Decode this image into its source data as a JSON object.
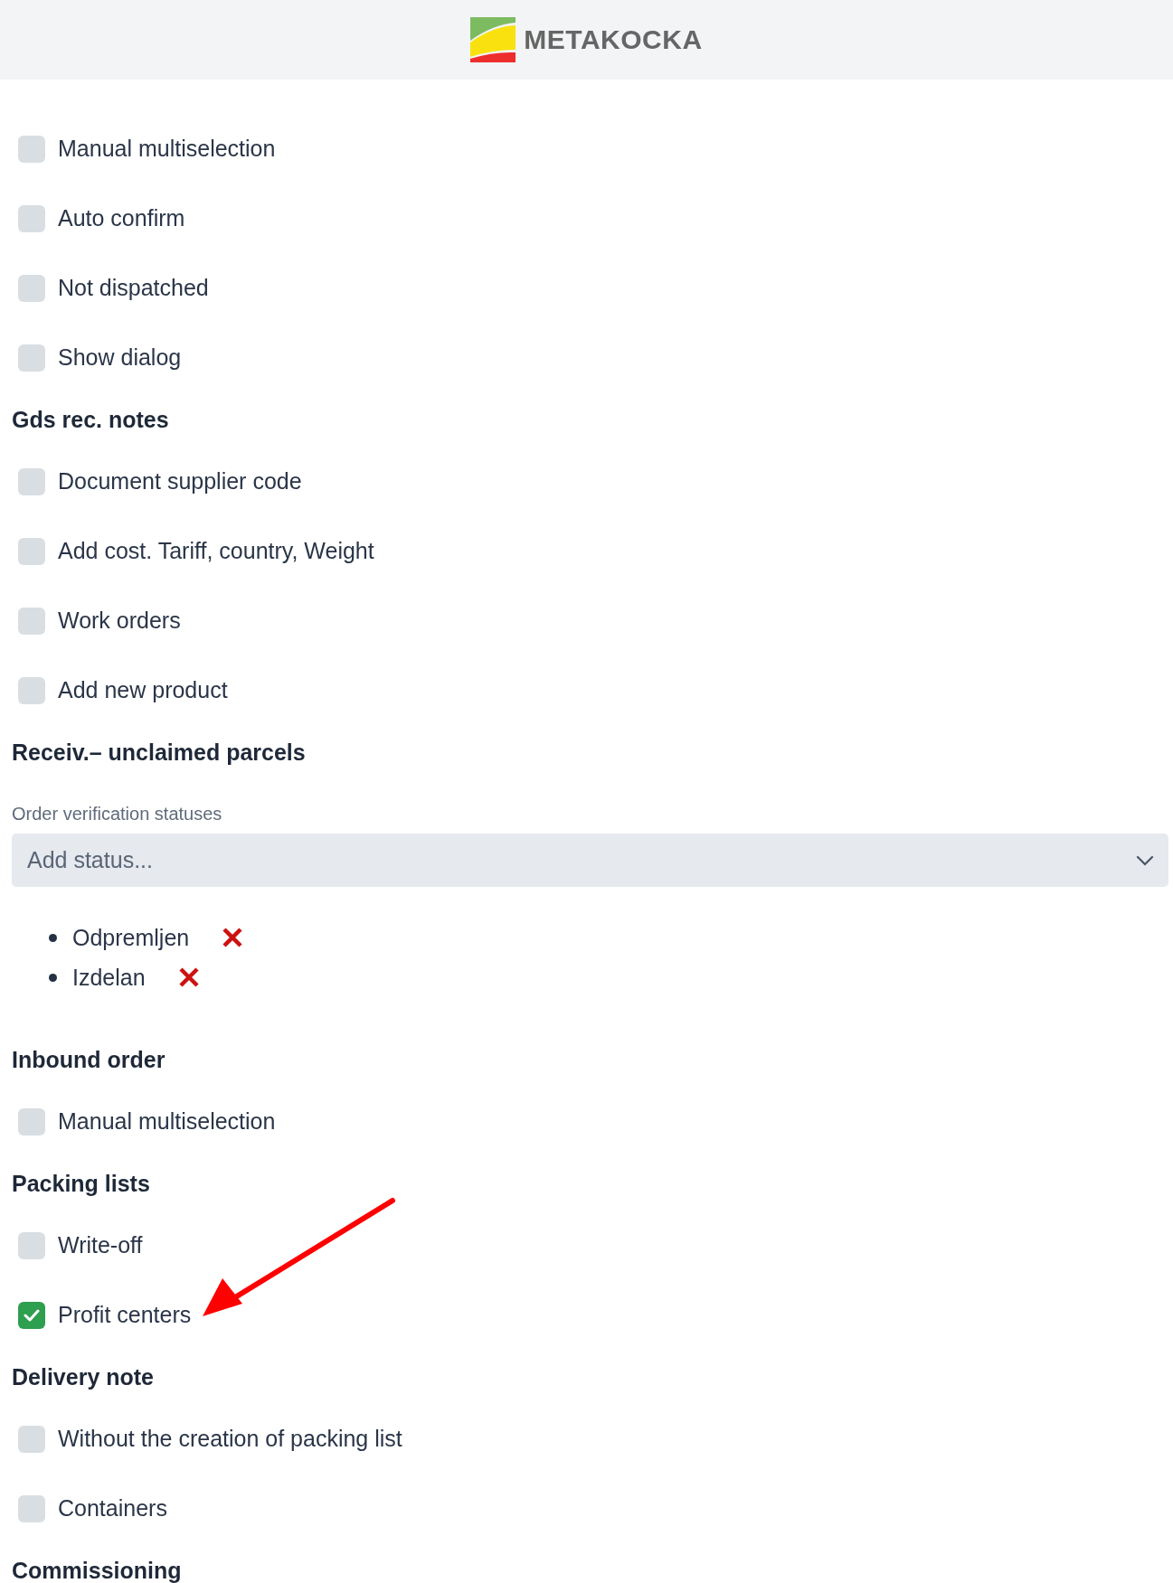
{
  "header": {
    "logo_text": "METAKOCKA"
  },
  "items": [
    {
      "kind": "checkbox",
      "label": "Manual multiselection",
      "checked": false
    },
    {
      "kind": "checkbox",
      "label": "Auto confirm",
      "checked": false
    },
    {
      "kind": "checkbox",
      "label": "Not dispatched",
      "checked": false
    },
    {
      "kind": "checkbox",
      "label": "Show dialog",
      "checked": false
    },
    {
      "kind": "heading",
      "label": "Gds rec. notes"
    },
    {
      "kind": "checkbox",
      "label": "Document supplier code",
      "checked": false
    },
    {
      "kind": "checkbox",
      "label": "Add cost. Tariff, country, Weight",
      "checked": false
    },
    {
      "kind": "checkbox",
      "label": "Work orders",
      "checked": false
    },
    {
      "kind": "checkbox",
      "label": "Add new product",
      "checked": false
    },
    {
      "kind": "heading",
      "label": "Receiv.– unclaimed parcels"
    },
    {
      "kind": "status_select",
      "label": "Order verification statuses",
      "placeholder": "Add status...",
      "statuses": [
        {
          "name": "Odpremljen"
        },
        {
          "name": "Izdelan"
        }
      ]
    },
    {
      "kind": "heading",
      "label": "Inbound order"
    },
    {
      "kind": "checkbox",
      "label": "Manual multiselection",
      "checked": false
    },
    {
      "kind": "heading",
      "label": "Packing lists"
    },
    {
      "kind": "checkbox",
      "label": "Write-off",
      "checked": false
    },
    {
      "kind": "checkbox",
      "label": "Profit centers",
      "checked": true
    },
    {
      "kind": "heading",
      "label": "Delivery note"
    },
    {
      "kind": "checkbox",
      "label": "Without the creation of packing list",
      "checked": false
    },
    {
      "kind": "checkbox",
      "label": "Containers",
      "checked": false
    },
    {
      "kind": "heading",
      "label": "Commissioning"
    }
  ]
}
